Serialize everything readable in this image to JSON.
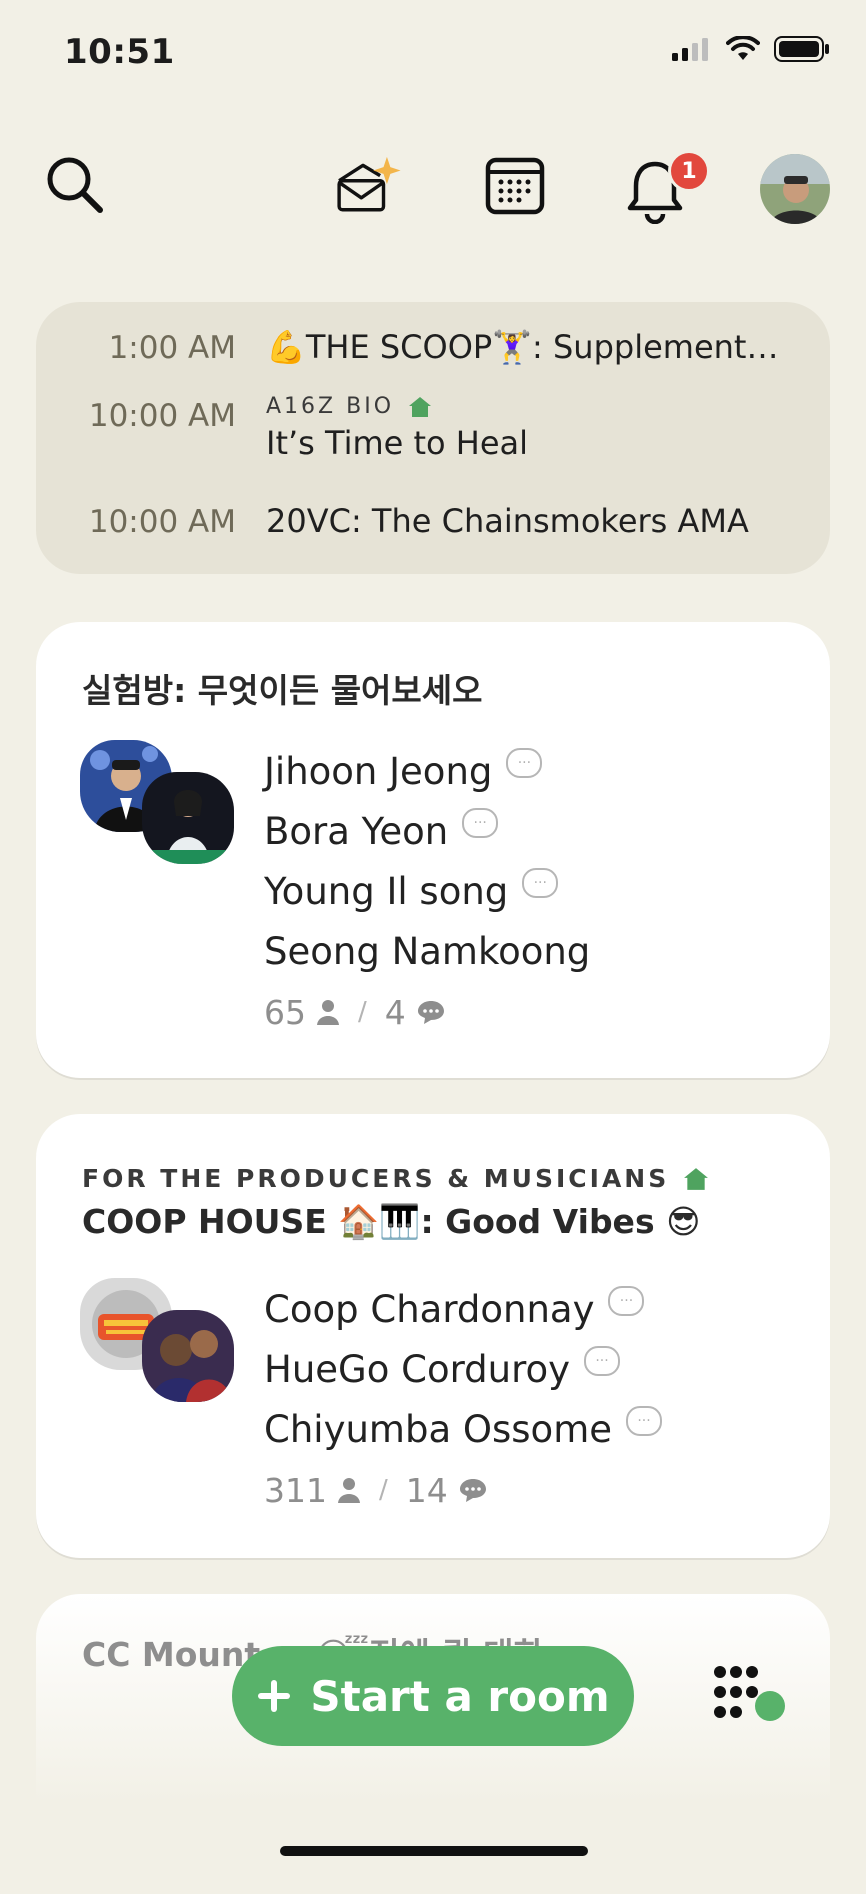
{
  "status_bar": {
    "time": "10:51"
  },
  "nav": {
    "icons": [
      "search-icon",
      "invite-envelope-icon",
      "calendar-icon",
      "bell-icon"
    ],
    "notification_count": "1"
  },
  "schedule": [
    {
      "time": "1:00 AM",
      "title": "💪THE SCOOP🏋️‍♀️: Supplement…"
    },
    {
      "time": "10:00 AM",
      "club": "A16Z BIO",
      "title": "It’s Time to Heal"
    },
    {
      "time": "10:00 AM",
      "title": "20VC: The Chainsmokers AMA"
    }
  ],
  "rooms": [
    {
      "title": "실험방: 무엇이든 물어보세오",
      "speakers": [
        "Jihoon Jeong",
        "Bora Yeon",
        "Young Il song",
        "Seong Namkoong"
      ],
      "listeners": "65",
      "speaking": "4"
    },
    {
      "club": "FOR THE PRODUCERS & MUSICIANS",
      "title": "COOP HOUSE 🏠🎹: Good Vibes 😎",
      "speakers": [
        "Coop Chardonnay",
        "HueGo Corduroy",
        "Chiyumba Ossome"
      ],
      "listeners": "311",
      "speaking": "14"
    }
  ],
  "partial_room": {
    "title": "CC Mount … 😴전에 퀵 대화s"
  },
  "start_room": {
    "label": "Start a room",
    "icon": "plus-icon"
  },
  "colors": {
    "background": "#F2F0E6",
    "accent_green": "#58B26A",
    "badge_red": "#E2483D",
    "club_green": "#4FA35F"
  }
}
